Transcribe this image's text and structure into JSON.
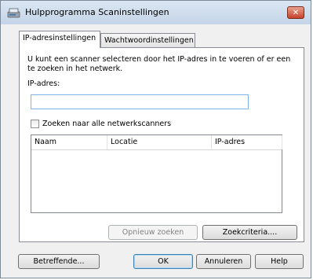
{
  "window": {
    "title": "Hulpprogramma Scaninstellingen",
    "close_symbol": "✕"
  },
  "tabs": [
    {
      "label": "IP-adresinstellingen",
      "active": true
    },
    {
      "label": "Wachtwoordinstellingen",
      "active": false
    }
  ],
  "ip_panel": {
    "description": "U kunt een scanner selecteren door het IP-adres in te voeren of er een te zoeken in het netwerk.",
    "ip_label": "IP-adres:",
    "ip_value": "",
    "search_all_label": "Zoeken naar alle netwerkscanners",
    "search_all_checked": false,
    "columns": [
      "Naam",
      "Locatie",
      "IP-adres"
    ],
    "rows": [],
    "reset_search_label": "Opnieuw zoeken",
    "criteria_label": "Zoekcriteria...."
  },
  "footer": {
    "about_label": "Betreffende...",
    "ok_label": "OK",
    "cancel_label": "Annuleren",
    "help_label": "Help"
  },
  "icons": {
    "title_icon": "scanner-icon",
    "close_icon": "close-icon"
  },
  "colors": {
    "titlebar": "#c4d5e8",
    "close_button": "#c7432b",
    "input_border": "#7eb4ea"
  }
}
